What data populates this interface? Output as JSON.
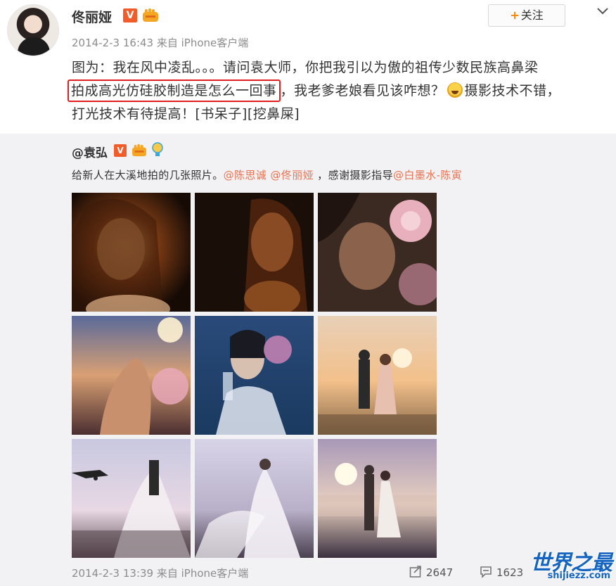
{
  "post": {
    "user_name": "佟丽娅",
    "verified_badge": "V",
    "timestamp": "2014-2-3 16:43",
    "source": "来自 iPhone客户端",
    "follow_label": "关注",
    "follow_plus": "+",
    "text_line1": "图为：我在风中凌乱。。。请问袁大师，你把我引以为傲的祖传少数民族高鼻梁",
    "text_highlight": "拍成高光仿硅胶制造是怎么一回事",
    "text_line2_rest": "，我老爹老娘看见该咋想？",
    "text_line2_after_emoji": "摄影技术不错，",
    "text_line3": "打光技术有待提高！[书呆子][挖鼻屎]"
  },
  "repost": {
    "user_name": "@袁弘",
    "verified_badge": "V",
    "text_prefix": "给新人在大溪地拍的几张照片。",
    "mention1": "@陈思诚",
    "mention2": "@佟丽娅",
    "text_middle": "，感谢摄影指导",
    "mention3": "@白墨水-陈寅",
    "timestamp": "2014-2-3 13:39",
    "source": "来自 iPhone客户端",
    "repost_count": "2647",
    "comment_count": "1623"
  },
  "watermark": {
    "title": "世界之最",
    "url": "shijiezz.com"
  },
  "icons": {
    "chevron": "chevron-down-icon",
    "repost": "repost-icon",
    "comment": "comment-icon"
  },
  "colors": {
    "mention": "#eb7350",
    "highlight_box": "#e02020",
    "follow_plus": "#ff8200",
    "watermark": "#1565c0",
    "repost_bg": "#f2f2f5"
  }
}
